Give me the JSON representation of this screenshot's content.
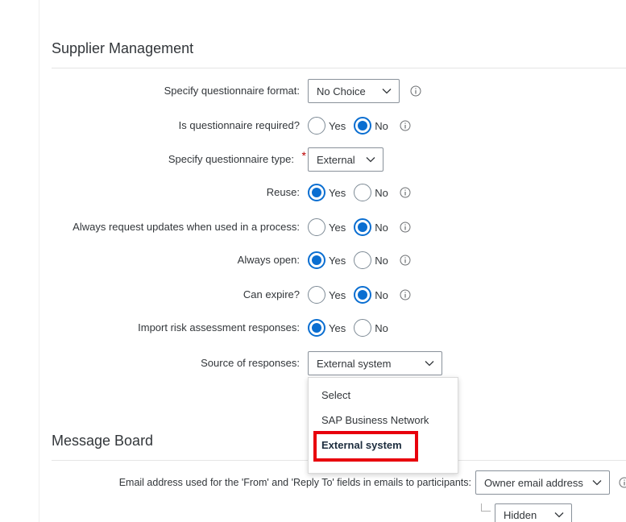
{
  "supplier_management": {
    "title": "Supplier Management",
    "fields": {
      "questionnaire_format": {
        "label": "Specify questionnaire format:",
        "value": "No Choice"
      },
      "questionnaire_required": {
        "label": "Is questionnaire required?",
        "selected": "No"
      },
      "questionnaire_type": {
        "label": "Specify questionnaire type:",
        "required_mark": "*",
        "value": "External"
      },
      "reuse": {
        "label": "Reuse:",
        "selected": "Yes"
      },
      "always_request_updates": {
        "label": "Always request updates when used in a process:",
        "selected": "No"
      },
      "always_open": {
        "label": "Always open:",
        "selected": "Yes"
      },
      "can_expire": {
        "label": "Can expire?",
        "selected": "No"
      },
      "import_risk": {
        "label": "Import risk assessment responses:",
        "selected": "Yes"
      },
      "source_of_responses": {
        "label": "Source of responses:",
        "value": "External system"
      }
    },
    "radio_options": {
      "yes": "Yes",
      "no": "No"
    }
  },
  "source_dropdown": {
    "options": [
      "Select",
      "SAP Business Network",
      "External system"
    ],
    "selected": "External system"
  },
  "message_board": {
    "title": "Message Board",
    "email_label": "Email address used for the 'From' and 'Reply To' fields in emails to participants:",
    "email_value": "Owner email address",
    "visibility_value": "Hidden"
  },
  "icons": {
    "info": "info-icon",
    "chevron": "chevron-down-icon"
  },
  "colors": {
    "accent": "#0a6ed1",
    "highlight": "#e8000d",
    "required": "#bb0000"
  }
}
